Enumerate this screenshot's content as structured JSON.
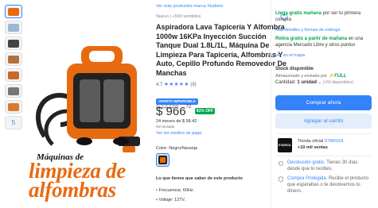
{
  "gallery": {
    "more_count": "5"
  },
  "promo": {
    "line1": "Máquinas de",
    "line2": "limpieza de",
    "line3": "alfombras"
  },
  "product": {
    "brand_link": "Ver más productos marca Xiudeen",
    "condition": "Nuevo  |  +500 vendidos",
    "title": "Aspiradora Lava Tapicería Y Alfombra 1000w 16KPa Inyección Succión Tanque Dual 1.8L/1L, Máquina De Limpieza Para Tapicería, Alfombras Y Auto, Cepillo Profundo Removedor De Manchas",
    "rating": "4.7",
    "stars": "★★★★★",
    "reviews": "(9)",
    "badge": "OFERTA IMPERDIBLE",
    "old_price": "$ 2,527",
    "old_cents": "66",
    "price": "$ 966",
    "price_cents": "72",
    "discount": "61% OFF",
    "installments": "24 meses de $ 58.42",
    "iva": "IVA incluido",
    "payment_link": "Ver los medios de pago",
    "color_label": "Color: Negro/Naranja",
    "features_title": "Lo que tienes que saber de este producto",
    "features": [
      "Frecuencia: 60Hz.",
      "Voltaje: 127V."
    ]
  },
  "shipping": {
    "line1_green": "Llega gratis mañana",
    "line1_rest": " por ser tu primera compra",
    "details_link": "Más detalles y formas de entrega",
    "pickup_green": "Retira gratis a partir de mañana",
    "pickup_rest": " en una agencia Mercado Libre y otros puntos",
    "map_link": "Ver en el mapa"
  },
  "stock": {
    "title": "Stock disponible",
    "stored": "Almacenado y enviado por",
    "full": "⚡FULL",
    "quantity_label": "Cantidad: ",
    "quantity_value": "1 unidad",
    "available": "(+50 disponibles)"
  },
  "actions": {
    "buy": "Comprar ahora",
    "cart": "Agregar al carrito"
  },
  "seller": {
    "logo_text": "STARSOL",
    "official": "Tienda oficial ",
    "name": "STARSOL",
    "sales": "+10 mil ventas"
  },
  "guarantees": [
    {
      "link": "Devolución gratis.",
      "text": " Tienes 30 días desde que lo recibes."
    },
    {
      "link": "Compra Protegida.",
      "text": " Recibe el producto que esperabas o te devolvemos tu dinero."
    }
  ],
  "colors": {
    "accent": "#3483fa",
    "green": "#00a650",
    "orange": "#e86a10"
  }
}
